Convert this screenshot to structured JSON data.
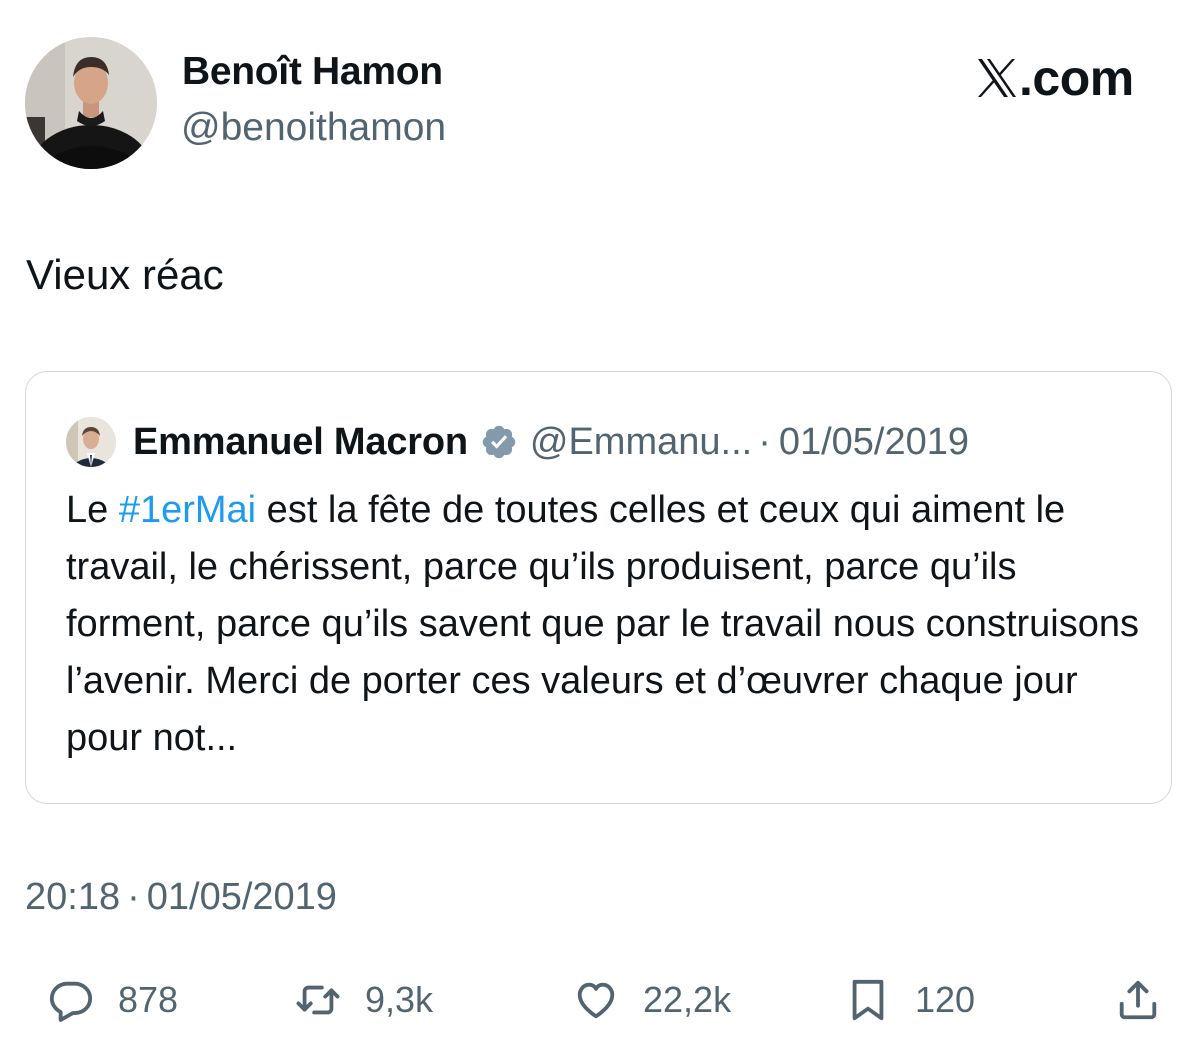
{
  "author": {
    "name": "Benoît Hamon",
    "handle": "@benoithamon"
  },
  "brand": {
    "text": ".com",
    "icon": "x-logo-icon"
  },
  "tweet": {
    "text": "Vieux réac"
  },
  "quoted_tweet": {
    "name": "Emmanuel Macron",
    "verified_icon": "verified-badge-icon",
    "handle": "@Emmanu...",
    "separator": "·",
    "date": "01/05/2019",
    "text_before": "Le ",
    "hashtag": "#1erMai",
    "text_after": " est la fête de toutes celles et ceux qui aiment le travail, le chérissent, parce qu’ils produisent, parce qu’ils forment, parce qu’ils savent que par le travail nous construisons l’avenir. Merci de porter ces valeurs et d’œuvrer chaque jour pour not..."
  },
  "timestamp": {
    "time": "20:18",
    "separator": "·",
    "date": "01/05/2019"
  },
  "actions": {
    "reply": {
      "icon": "reply-icon",
      "count": "878"
    },
    "retweet": {
      "icon": "retweet-icon",
      "count": "9,3k"
    },
    "like": {
      "icon": "heart-icon",
      "count": "22,2k"
    },
    "bookmark": {
      "icon": "bookmark-icon",
      "count": "120"
    },
    "share": {
      "icon": "share-icon"
    }
  },
  "colors": {
    "text": "#0f1419",
    "secondary": "#536471",
    "link": "#1d9bf0",
    "border": "#cfd9de",
    "verified": "#829aab"
  }
}
